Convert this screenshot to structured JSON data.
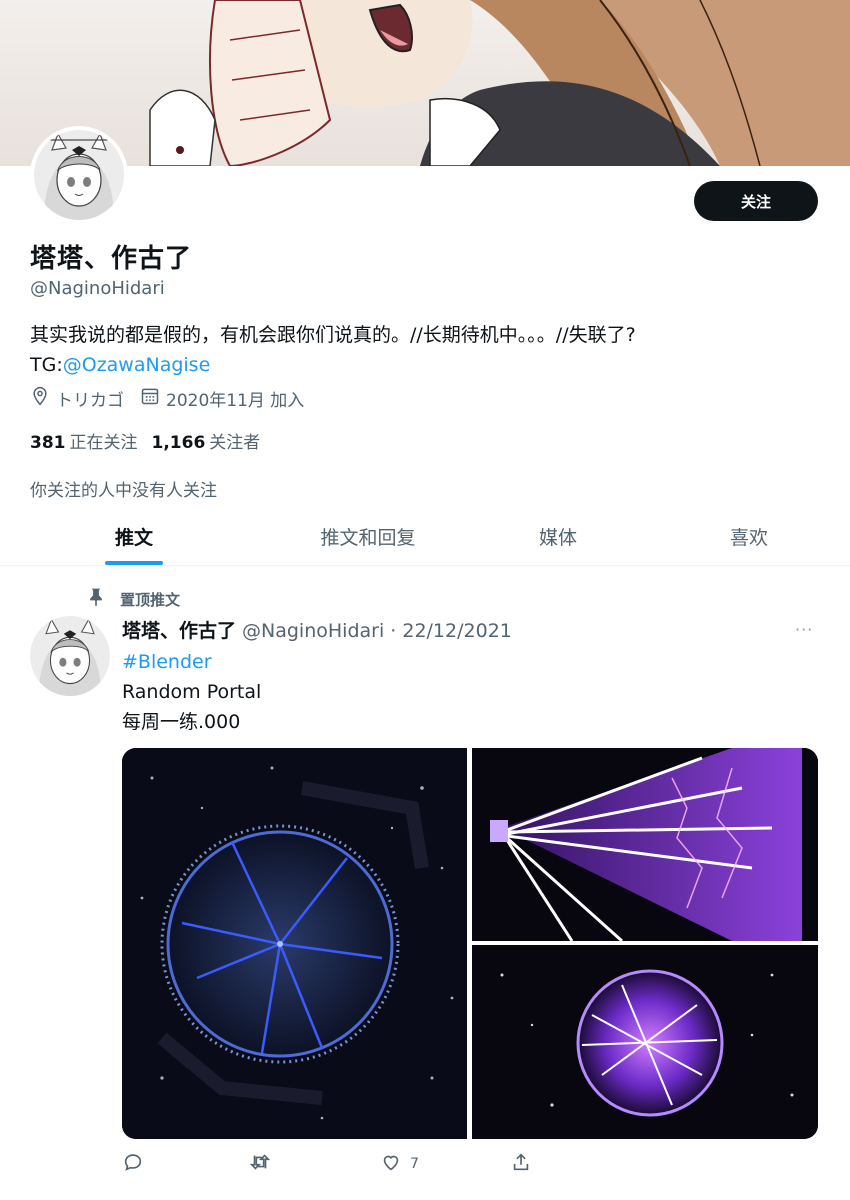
{
  "profile": {
    "display_name": "塔塔、作古了",
    "handle": "@NaginoHidari",
    "follow_label": "关注",
    "bio_text": "其实我说的都是假的，有机会跟你们说真的。//长期待机中。。。//失联了?",
    "bio_tg_prefix": "TG:",
    "bio_tg_link": "@OzawaNagise",
    "location": "トリカゴ",
    "joined": "2020年11月 加入",
    "following_count": "381",
    "following_label": "正在关注",
    "followers_count": "1,166",
    "followers_label": "关注者",
    "mutual_note": "你关注的人中没有人关注"
  },
  "tabs": [
    {
      "label": "推文",
      "active": true
    },
    {
      "label": "推文和回复",
      "active": false
    },
    {
      "label": "媒体",
      "active": false
    },
    {
      "label": "喜欢",
      "active": false
    }
  ],
  "tweet": {
    "pinned_label": "置顶推文",
    "author_name": "塔塔、作古了",
    "author_handle_date": "@NaginoHidari · 22/12/2021",
    "more_label": "···",
    "hashtag": "#Blender",
    "line1": "Random Portal",
    "line2": "每周一练.000",
    "like_count": "7"
  },
  "icons": [
    "location-icon",
    "calendar-icon",
    "pin-icon",
    "reply-icon",
    "retweet-icon",
    "like-icon",
    "share-icon",
    "more-icon"
  ],
  "colors": {
    "accent": "#1d9bf0",
    "text": "#0f1419",
    "secondary": "#536471"
  }
}
